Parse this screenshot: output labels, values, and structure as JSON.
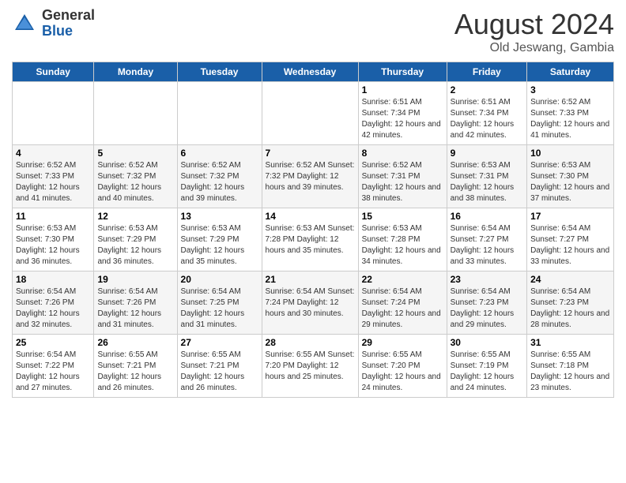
{
  "header": {
    "logo_general": "General",
    "logo_blue": "Blue",
    "title": "August 2024",
    "subtitle": "Old Jeswang, Gambia"
  },
  "calendar": {
    "days_of_week": [
      "Sunday",
      "Monday",
      "Tuesday",
      "Wednesday",
      "Thursday",
      "Friday",
      "Saturday"
    ],
    "weeks": [
      [
        {
          "day": "",
          "info": ""
        },
        {
          "day": "",
          "info": ""
        },
        {
          "day": "",
          "info": ""
        },
        {
          "day": "",
          "info": ""
        },
        {
          "day": "1",
          "info": "Sunrise: 6:51 AM\nSunset: 7:34 PM\nDaylight: 12 hours\nand 42 minutes."
        },
        {
          "day": "2",
          "info": "Sunrise: 6:51 AM\nSunset: 7:34 PM\nDaylight: 12 hours\nand 42 minutes."
        },
        {
          "day": "3",
          "info": "Sunrise: 6:52 AM\nSunset: 7:33 PM\nDaylight: 12 hours\nand 41 minutes."
        }
      ],
      [
        {
          "day": "4",
          "info": "Sunrise: 6:52 AM\nSunset: 7:33 PM\nDaylight: 12 hours\nand 41 minutes."
        },
        {
          "day": "5",
          "info": "Sunrise: 6:52 AM\nSunset: 7:32 PM\nDaylight: 12 hours\nand 40 minutes."
        },
        {
          "day": "6",
          "info": "Sunrise: 6:52 AM\nSunset: 7:32 PM\nDaylight: 12 hours\nand 39 minutes."
        },
        {
          "day": "7",
          "info": "Sunrise: 6:52 AM\nSunset: 7:32 PM\nDaylight: 12 hours\nand 39 minutes."
        },
        {
          "day": "8",
          "info": "Sunrise: 6:52 AM\nSunset: 7:31 PM\nDaylight: 12 hours\nand 38 minutes."
        },
        {
          "day": "9",
          "info": "Sunrise: 6:53 AM\nSunset: 7:31 PM\nDaylight: 12 hours\nand 38 minutes."
        },
        {
          "day": "10",
          "info": "Sunrise: 6:53 AM\nSunset: 7:30 PM\nDaylight: 12 hours\nand 37 minutes."
        }
      ],
      [
        {
          "day": "11",
          "info": "Sunrise: 6:53 AM\nSunset: 7:30 PM\nDaylight: 12 hours\nand 36 minutes."
        },
        {
          "day": "12",
          "info": "Sunrise: 6:53 AM\nSunset: 7:29 PM\nDaylight: 12 hours\nand 36 minutes."
        },
        {
          "day": "13",
          "info": "Sunrise: 6:53 AM\nSunset: 7:29 PM\nDaylight: 12 hours\nand 35 minutes."
        },
        {
          "day": "14",
          "info": "Sunrise: 6:53 AM\nSunset: 7:28 PM\nDaylight: 12 hours\nand 35 minutes."
        },
        {
          "day": "15",
          "info": "Sunrise: 6:53 AM\nSunset: 7:28 PM\nDaylight: 12 hours\nand 34 minutes."
        },
        {
          "day": "16",
          "info": "Sunrise: 6:54 AM\nSunset: 7:27 PM\nDaylight: 12 hours\nand 33 minutes."
        },
        {
          "day": "17",
          "info": "Sunrise: 6:54 AM\nSunset: 7:27 PM\nDaylight: 12 hours\nand 33 minutes."
        }
      ],
      [
        {
          "day": "18",
          "info": "Sunrise: 6:54 AM\nSunset: 7:26 PM\nDaylight: 12 hours\nand 32 minutes."
        },
        {
          "day": "19",
          "info": "Sunrise: 6:54 AM\nSunset: 7:26 PM\nDaylight: 12 hours\nand 31 minutes."
        },
        {
          "day": "20",
          "info": "Sunrise: 6:54 AM\nSunset: 7:25 PM\nDaylight: 12 hours\nand 31 minutes."
        },
        {
          "day": "21",
          "info": "Sunrise: 6:54 AM\nSunset: 7:24 PM\nDaylight: 12 hours\nand 30 minutes."
        },
        {
          "day": "22",
          "info": "Sunrise: 6:54 AM\nSunset: 7:24 PM\nDaylight: 12 hours\nand 29 minutes."
        },
        {
          "day": "23",
          "info": "Sunrise: 6:54 AM\nSunset: 7:23 PM\nDaylight: 12 hours\nand 29 minutes."
        },
        {
          "day": "24",
          "info": "Sunrise: 6:54 AM\nSunset: 7:23 PM\nDaylight: 12 hours\nand 28 minutes."
        }
      ],
      [
        {
          "day": "25",
          "info": "Sunrise: 6:54 AM\nSunset: 7:22 PM\nDaylight: 12 hours\nand 27 minutes."
        },
        {
          "day": "26",
          "info": "Sunrise: 6:55 AM\nSunset: 7:21 PM\nDaylight: 12 hours\nand 26 minutes."
        },
        {
          "day": "27",
          "info": "Sunrise: 6:55 AM\nSunset: 7:21 PM\nDaylight: 12 hours\nand 26 minutes."
        },
        {
          "day": "28",
          "info": "Sunrise: 6:55 AM\nSunset: 7:20 PM\nDaylight: 12 hours\nand 25 minutes."
        },
        {
          "day": "29",
          "info": "Sunrise: 6:55 AM\nSunset: 7:20 PM\nDaylight: 12 hours\nand 24 minutes."
        },
        {
          "day": "30",
          "info": "Sunrise: 6:55 AM\nSunset: 7:19 PM\nDaylight: 12 hours\nand 24 minutes."
        },
        {
          "day": "31",
          "info": "Sunrise: 6:55 AM\nSunset: 7:18 PM\nDaylight: 12 hours\nand 23 minutes."
        }
      ]
    ]
  }
}
